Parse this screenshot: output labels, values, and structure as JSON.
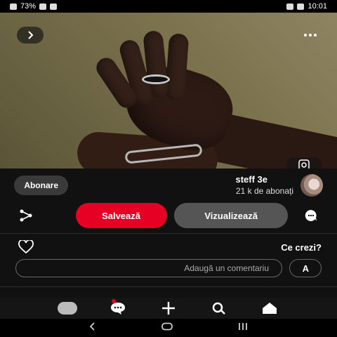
{
  "status_bar": {
    "time": "10:01",
    "battery": "73%"
  },
  "pin": {
    "image_alt": "hands with silver ring and bracelet"
  },
  "creator": {
    "name": "steff 3e",
    "followers": "21 k de abonați",
    "follow_label": "Abonare"
  },
  "actions": {
    "visit_label": "Vizualizează",
    "save_label": "Salvează"
  },
  "comments": {
    "title": "Ce crezi?",
    "initial": "A",
    "input_placeholder": "Adaugă un comentariu"
  },
  "colors": {
    "accent": "#e60023",
    "background": "#111111",
    "pill": "#555555"
  },
  "icons": [
    "back-chevron-icon",
    "more-icon",
    "visual-search-icon",
    "comment-icon",
    "share-icon",
    "heart-icon",
    "home-icon",
    "search-icon",
    "add-icon",
    "chat-icon",
    "profile-icon"
  ]
}
